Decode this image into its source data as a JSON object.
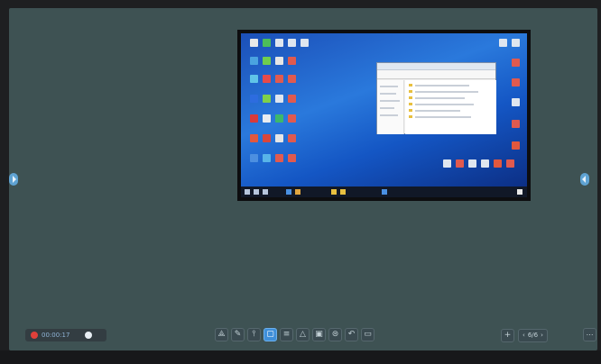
{
  "recording": {
    "time": "00:00:17"
  },
  "toolbar": {
    "tools": [
      {
        "name": "tool-select",
        "glyph": "⟁"
      },
      {
        "name": "tool-pen",
        "glyph": "✎"
      },
      {
        "name": "tool-brush",
        "glyph": "⫯"
      },
      {
        "name": "tool-eraser",
        "glyph": "▢"
      },
      {
        "name": "tool-text",
        "glyph": "≡"
      },
      {
        "name": "tool-shape",
        "glyph": "△"
      },
      {
        "name": "tool-image",
        "glyph": "▣"
      },
      {
        "name": "tool-clear",
        "glyph": "⊜"
      },
      {
        "name": "tool-undo",
        "glyph": "↶"
      },
      {
        "name": "tool-redo",
        "glyph": "▭"
      }
    ],
    "active_tool": "tool-eraser"
  },
  "pager": {
    "label": "6/6"
  },
  "colors": {
    "board": "#3e5253",
    "accent": "#3f8fd9"
  }
}
